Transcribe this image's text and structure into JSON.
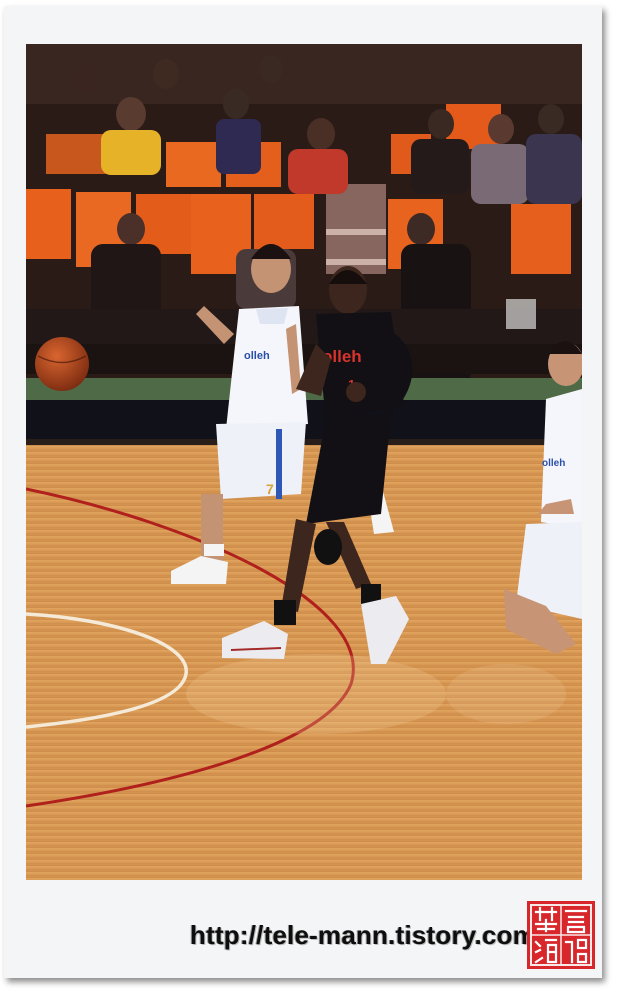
{
  "watermark": {
    "url": "http://tele-mann.tistory.com"
  },
  "jersey": {
    "sponsor": "olleh",
    "dark_number": "1",
    "light_number": "7",
    "light_sponsor": "olleh"
  },
  "seal": {
    "chars": [
      "難",
      "言",
      "道",
      "醋"
    ]
  },
  "colors": {
    "court_wood": "#d89a52",
    "court_line_red": "#b0201c",
    "seat_orange": "#e85d1e",
    "seal_red": "#d8272b"
  }
}
